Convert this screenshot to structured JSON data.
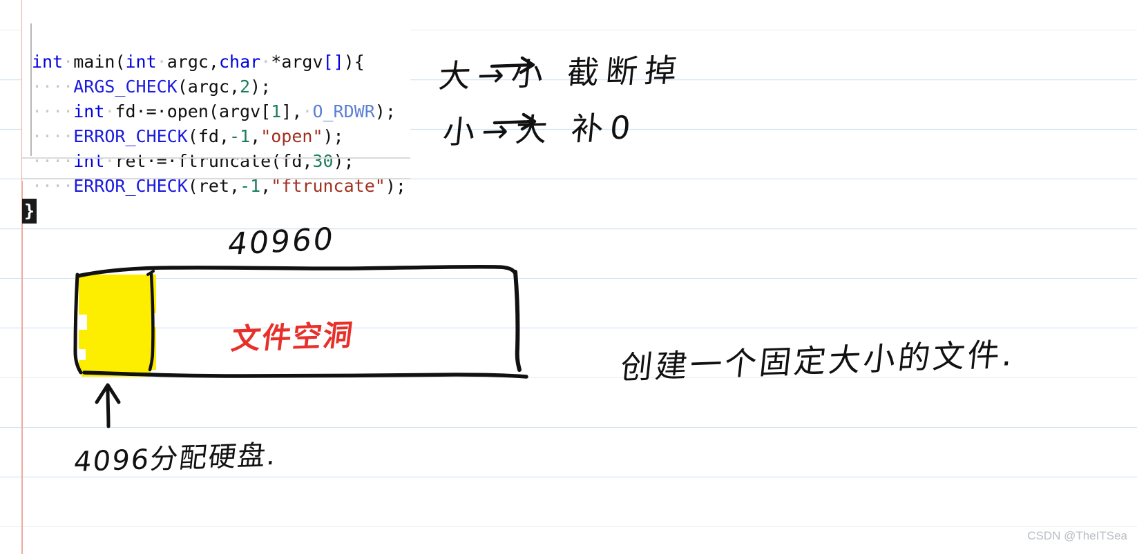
{
  "page": {
    "background": "#ffffff",
    "rule_color": "#cfe2f3",
    "margin_rule_color": "#f1a9a0"
  },
  "code_editor": {
    "language": "c",
    "lines": [
      {
        "indent_dots": "",
        "tokens": [
          {
            "t": "int",
            "c": "kw"
          },
          {
            "t": "·",
            "c": "ws"
          },
          {
            "t": "main",
            "c": "fn"
          },
          {
            "t": "(",
            "c": "punc"
          },
          {
            "t": "int",
            "c": "kw"
          },
          {
            "t": "·",
            "c": "ws"
          },
          {
            "t": "argc,",
            "c": "fn"
          },
          {
            "t": "char",
            "c": "kw"
          },
          {
            "t": "·",
            "c": "ws"
          },
          {
            "t": "*argv",
            "c": "fn"
          },
          {
            "t": "[]",
            "c": "kw"
          },
          {
            "t": "){",
            "c": "punc"
          }
        ]
      },
      {
        "indent_dots": "····",
        "tokens": [
          {
            "t": "ARGS_CHECK",
            "c": "macro"
          },
          {
            "t": "(argc,",
            "c": "punc"
          },
          {
            "t": "2",
            "c": "num"
          },
          {
            "t": ");",
            "c": "punc"
          }
        ]
      },
      {
        "indent_dots": "····",
        "tokens": [
          {
            "t": "int",
            "c": "kw"
          },
          {
            "t": "·",
            "c": "ws"
          },
          {
            "t": "fd",
            "c": "fn"
          },
          {
            "t": "·=·",
            "c": "punc"
          },
          {
            "t": "open(argv[",
            "c": "fn"
          },
          {
            "t": "1",
            "c": "num"
          },
          {
            "t": "],",
            "c": "punc"
          },
          {
            "t": "·",
            "c": "ws"
          },
          {
            "t": "O_RDWR",
            "c": "const"
          },
          {
            "t": ");",
            "c": "punc"
          }
        ]
      },
      {
        "indent_dots": "····",
        "tokens": [
          {
            "t": "ERROR_CHECK",
            "c": "macro"
          },
          {
            "t": "(fd,",
            "c": "punc"
          },
          {
            "t": "-1",
            "c": "num"
          },
          {
            "t": ",",
            "c": "punc"
          },
          {
            "t": "\"open\"",
            "c": "str"
          },
          {
            "t": ");",
            "c": "punc"
          }
        ]
      },
      {
        "indent_dots": "····",
        "tokens": [
          {
            "t": "int",
            "c": "kw"
          },
          {
            "t": "·",
            "c": "ws"
          },
          {
            "t": "ret",
            "c": "fn"
          },
          {
            "t": "·=·",
            "c": "punc"
          },
          {
            "t": "ftruncate(fd,",
            "c": "fn"
          },
          {
            "t": "30",
            "c": "num"
          },
          {
            "t": ");",
            "c": "punc"
          }
        ]
      },
      {
        "indent_dots": "····",
        "tokens": [
          {
            "t": "ERROR_CHECK",
            "c": "macro"
          },
          {
            "t": "(ret,",
            "c": "punc"
          },
          {
            "t": "-1",
            "c": "num"
          },
          {
            "t": ",",
            "c": "punc"
          },
          {
            "t": "\"ftruncate\"",
            "c": "str"
          },
          {
            "t": ");",
            "c": "punc"
          }
        ]
      }
    ],
    "closing_brace": "}"
  },
  "annotations": {
    "rule_big_to_small": "大→小  截断掉",
    "rule_small_to_big": "小→大  补0",
    "file_size_label": "40960",
    "file_hole_label": "文件空洞",
    "file_hole_color": "#e8302a",
    "right_note": "创建一个固定大小的文件.",
    "bottom_note": "4096分配硬盘.",
    "highlight_color": "#fdee00"
  },
  "watermark": {
    "text": "CSDN @TheITSea",
    "color": "#b9bec4"
  }
}
